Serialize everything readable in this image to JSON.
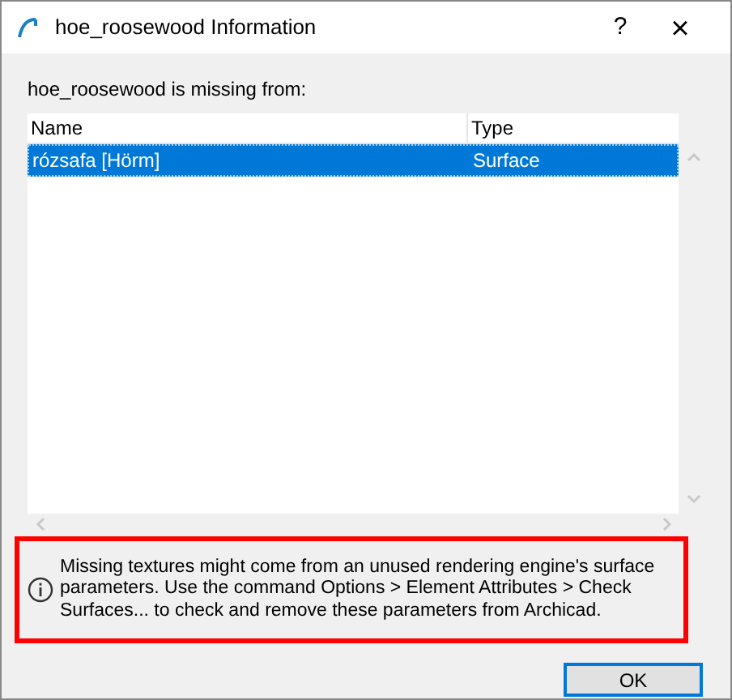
{
  "window": {
    "title": "hoe_roosewood Information",
    "help": "?",
    "close": "×"
  },
  "label": "hoe_roosewood is missing from:",
  "table": {
    "columns": [
      "Name",
      "Type"
    ],
    "rows": [
      {
        "cells": [
          "rózsafa [Hörm]",
          "Surface"
        ],
        "selected": true
      }
    ]
  },
  "note": "Missing textures might come from an unused rendering engine's surface parameters. Use the command Options > Element Attributes > Check Surfaces... to check and remove these parameters from Archicad.",
  "buttons": [
    "OK"
  ]
}
